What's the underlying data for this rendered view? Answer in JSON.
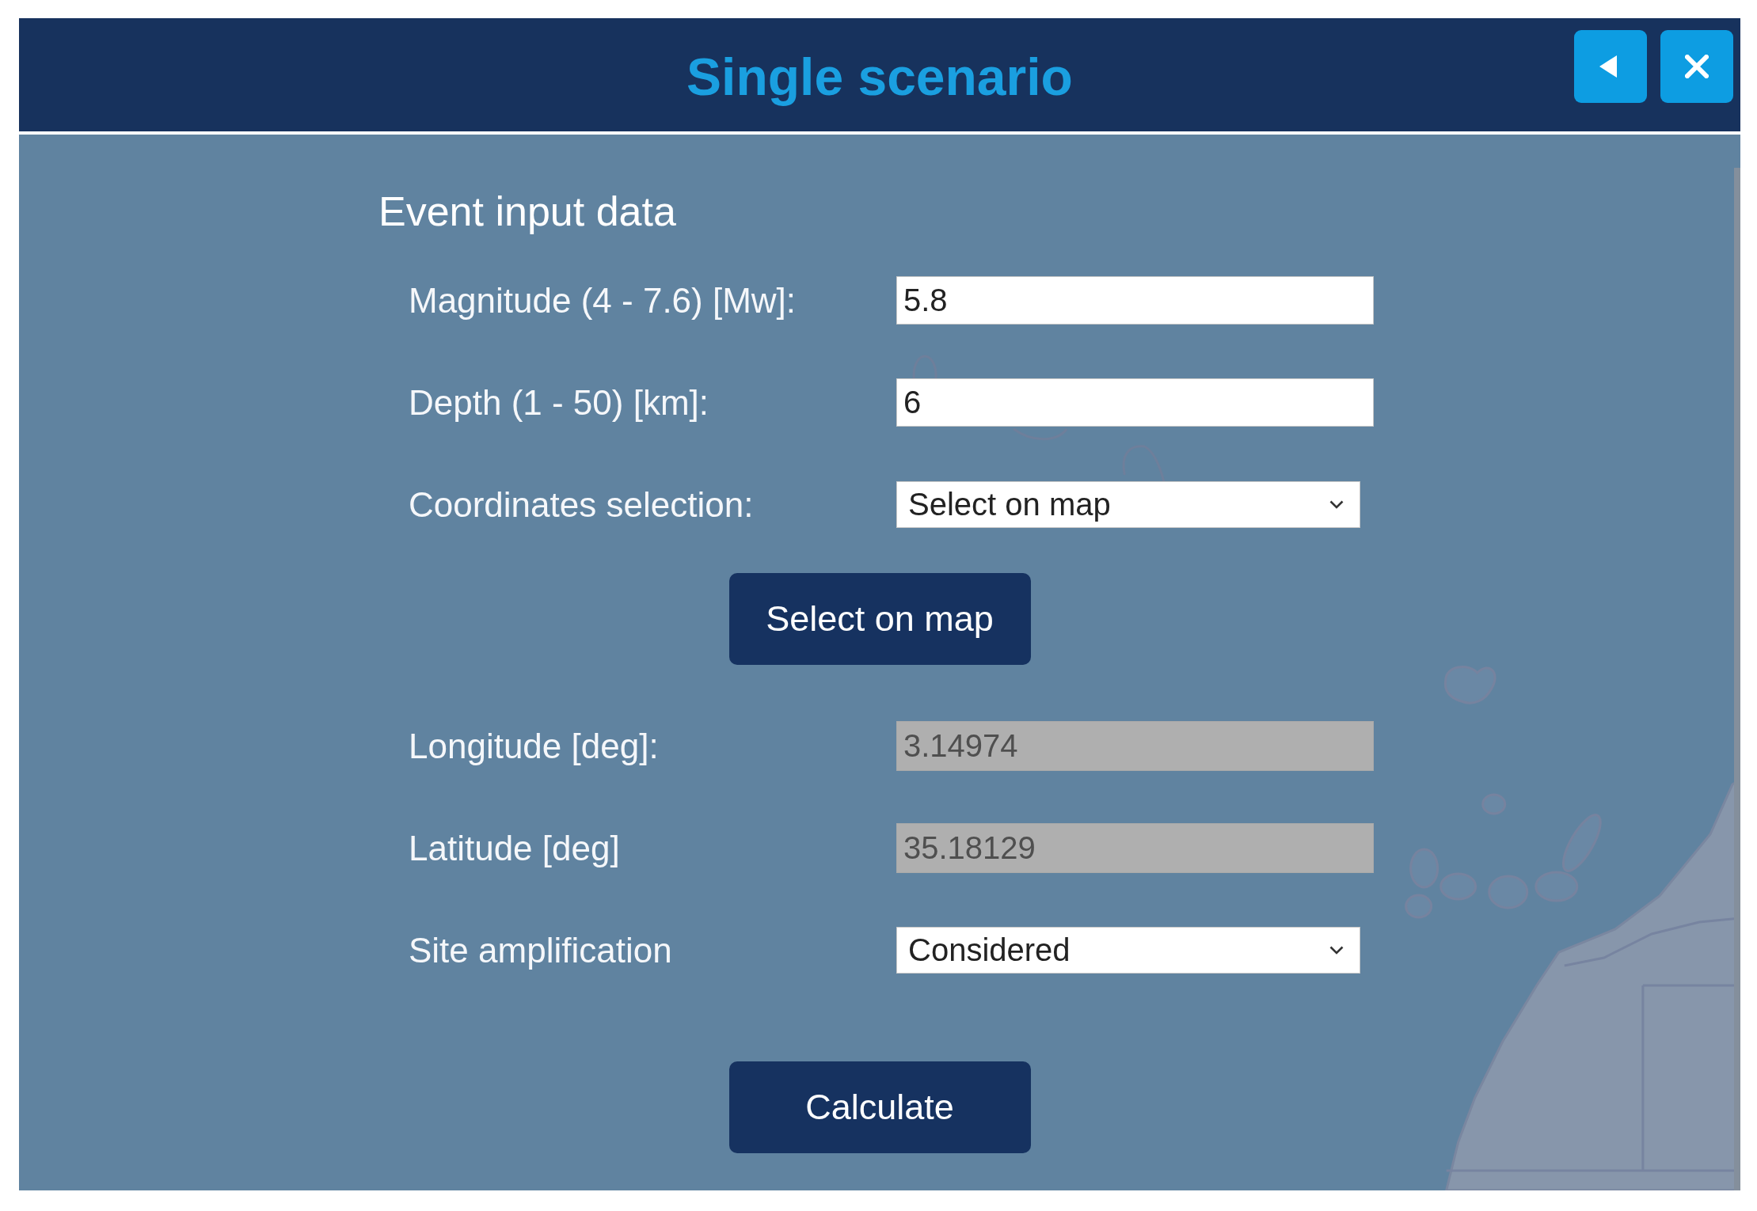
{
  "window": {
    "title": "Single scenario"
  },
  "section": {
    "title": "Event input data"
  },
  "form": {
    "rows": [
      {
        "kind": "input",
        "label": "Magnitude (4 - 7.6) [Mw]:",
        "value": "5.8",
        "disabled": false
      },
      {
        "kind": "input",
        "label": "Depth (1 - 50) [km]:",
        "value": "6",
        "disabled": false
      },
      {
        "kind": "select",
        "label": "Coordinates selection:",
        "value": "Select on map"
      },
      {
        "kind": "button",
        "label": "Select on map"
      },
      {
        "kind": "input",
        "label": "Longitude [deg]:",
        "value": "3.14974",
        "disabled": true
      },
      {
        "kind": "input",
        "label": "Latitude [deg]",
        "value": "35.18129",
        "disabled": true
      },
      {
        "kind": "select",
        "label": "Site amplification",
        "value": "Considered"
      }
    ],
    "submit_button": {
      "label": "Calculate"
    }
  }
}
